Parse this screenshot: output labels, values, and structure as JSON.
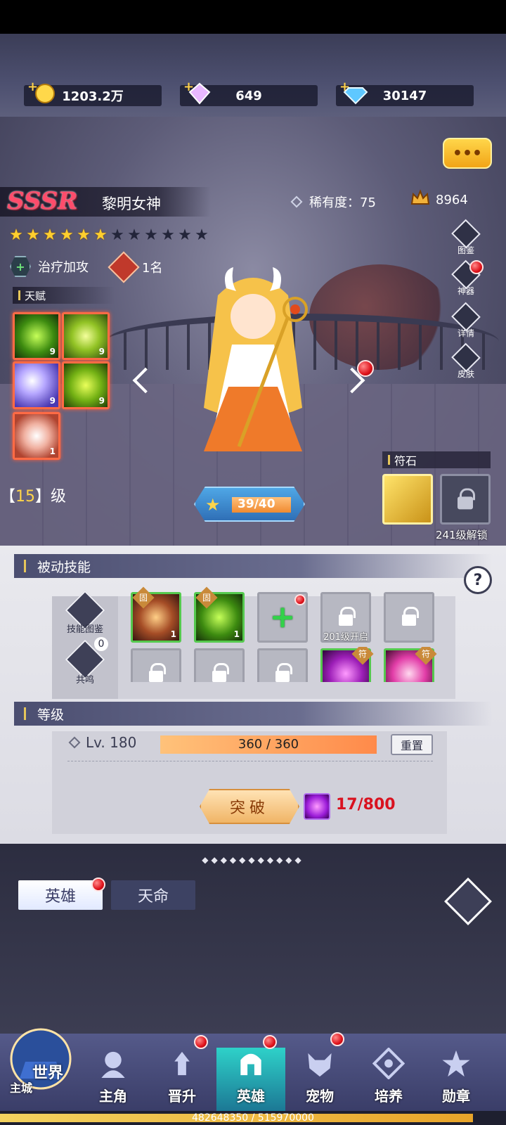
{
  "currencies": [
    {
      "icon": "gold-coin-icon",
      "value": "1203.2万"
    },
    {
      "icon": "rainbow-crystal-icon",
      "value": "649"
    },
    {
      "icon": "blue-diamond-icon",
      "value": "30147"
    }
  ],
  "hero": {
    "grade": "SSSR",
    "name": "黎明女神",
    "rarity_label": "稀有度：75",
    "power": "8964",
    "stars_filled": 6,
    "stars_total": 12,
    "role": "治疗加攻",
    "rank": "1名",
    "level_prefix": "【",
    "level_num": "15",
    "level_suffix": "】级",
    "exp": "39/40"
  },
  "talent": {
    "title": "天赋",
    "items": [
      {
        "icon": "green-slash-skill-icon",
        "level": "9"
      },
      {
        "icon": "green-swirl-skill-icon",
        "level": "9"
      },
      {
        "icon": "purple-wave-skill-icon",
        "level": "9"
      },
      {
        "icon": "green-beast-skill-icon",
        "level": "9"
      },
      {
        "icon": "gear-eye-skill-icon",
        "level": "1"
      }
    ]
  },
  "side_buttons": [
    {
      "label": "图鉴",
      "dot": false
    },
    {
      "label": "神器",
      "dot": true
    },
    {
      "label": "详情",
      "dot": false
    },
    {
      "label": "皮肤",
      "dot": false
    }
  ],
  "rune": {
    "title": "符石",
    "unlock_text": "241级解锁"
  },
  "passive": {
    "title": "被动技能",
    "help": "?",
    "side_buttons": [
      "技能图鉴",
      "共鸣"
    ],
    "resonance_count": "0",
    "fixed_tag": "固",
    "rune_tag": "符",
    "slots": [
      {
        "type": "skill",
        "tag": "固",
        "level": "1"
      },
      {
        "type": "skill",
        "tag": "固",
        "level": "1"
      },
      {
        "type": "add"
      },
      {
        "type": "locked",
        "caption": "201级开启"
      },
      {
        "type": "locked",
        "caption": ""
      },
      {
        "type": "locked"
      },
      {
        "type": "locked"
      },
      {
        "type": "locked"
      },
      {
        "type": "rune-skill",
        "tag": "符"
      },
      {
        "type": "rune-skill",
        "tag": "符"
      }
    ]
  },
  "level": {
    "title": "等级",
    "label": "Lv. 180",
    "progress_fraction": 1.0,
    "progress_text": "360 / 360",
    "reset": "重置",
    "breakthrough": "突破",
    "cost": "17/800"
  },
  "tabs": {
    "active": "英雄",
    "idle": "天命"
  },
  "nav": {
    "world": "世界",
    "home": "主城",
    "items": [
      {
        "label": "主角",
        "dot": false
      },
      {
        "label": "晋升",
        "dot": true
      },
      {
        "label": "英雄",
        "dot": true,
        "active": true
      },
      {
        "label": "宠物",
        "dot": true
      },
      {
        "label": "培养",
        "dot": false
      },
      {
        "label": "勋章",
        "dot": false
      }
    ]
  },
  "xp": {
    "text": "482648350 / 515970000",
    "fraction": 0.935
  },
  "colors": {
    "accent_gold": "#ffcf2e",
    "sssr_red": "#ff4c6b",
    "cost_red": "#d9121f",
    "frame_orange": "#ff6b45"
  }
}
